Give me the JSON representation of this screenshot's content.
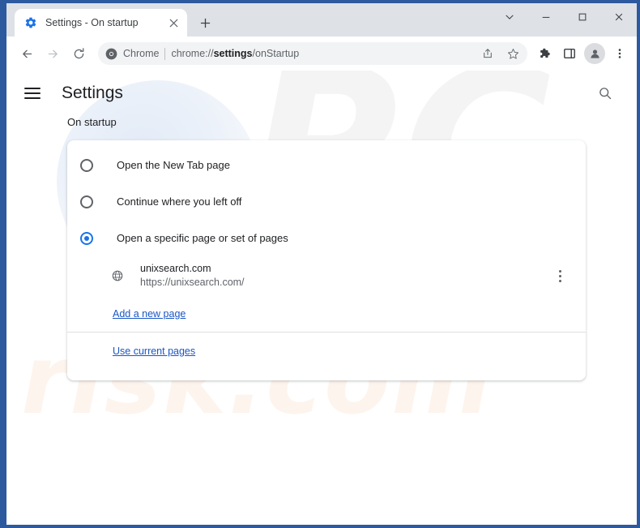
{
  "browser": {
    "tab": {
      "title": "Settings - On startup",
      "favicon_icon": "gear-icon",
      "close_icon": "close-icon"
    },
    "new_tab_icon": "plus-icon",
    "window_controls": [
      {
        "name": "tab-search",
        "icon": "chevron-down-icon"
      },
      {
        "name": "minimize",
        "icon": "minimize-icon"
      },
      {
        "name": "maximize",
        "icon": "maximize-icon"
      },
      {
        "name": "close",
        "icon": "close-icon"
      }
    ],
    "nav": {
      "back_icon": "arrow-left-icon",
      "forward_icon": "arrow-right-icon",
      "reload_icon": "reload-icon"
    },
    "omnibox": {
      "chrome_icon": "chrome-logo-icon",
      "chrome_label": "Chrome",
      "url_prefix": "chrome://",
      "url_bold": "settings",
      "url_suffix": "/onStartup",
      "url_full": "chrome://settings/onStartup",
      "share_icon": "share-icon",
      "bookmark_icon": "star-icon"
    },
    "toolbar_icons": [
      {
        "name": "extensions-button",
        "icon": "puzzle-icon"
      },
      {
        "name": "side-panel-button",
        "icon": "side-panel-icon"
      },
      {
        "name": "profile-avatar",
        "icon": "person-icon"
      },
      {
        "name": "chrome-menu-button",
        "icon": "kebab-menu-icon"
      }
    ]
  },
  "settings": {
    "menu_icon": "hamburger-icon",
    "title": "Settings",
    "search_icon": "search-icon",
    "section_label": "On startup",
    "startup_options": [
      {
        "label": "Open the New Tab page",
        "selected": false
      },
      {
        "label": "Continue where you left off",
        "selected": false
      },
      {
        "label": "Open a specific page or set of pages",
        "selected": true
      }
    ],
    "startup_pages": [
      {
        "name": "unixsearch.com",
        "url": "https://unixsearch.com/",
        "favicon_icon": "globe-icon",
        "menu_icon": "kebab-menu-icon"
      }
    ],
    "add_page_link": "Add a new page",
    "use_current_pages_link": "Use current pages"
  },
  "watermarks": {
    "pc": "PC",
    "risk": "risk.com"
  },
  "colors": {
    "accent": "#1a73e8",
    "link": "#1a56c4",
    "frame": "#2d5a9e",
    "titlebar": "#dee1e6",
    "text": "#202124",
    "muted": "#5f6368"
  }
}
